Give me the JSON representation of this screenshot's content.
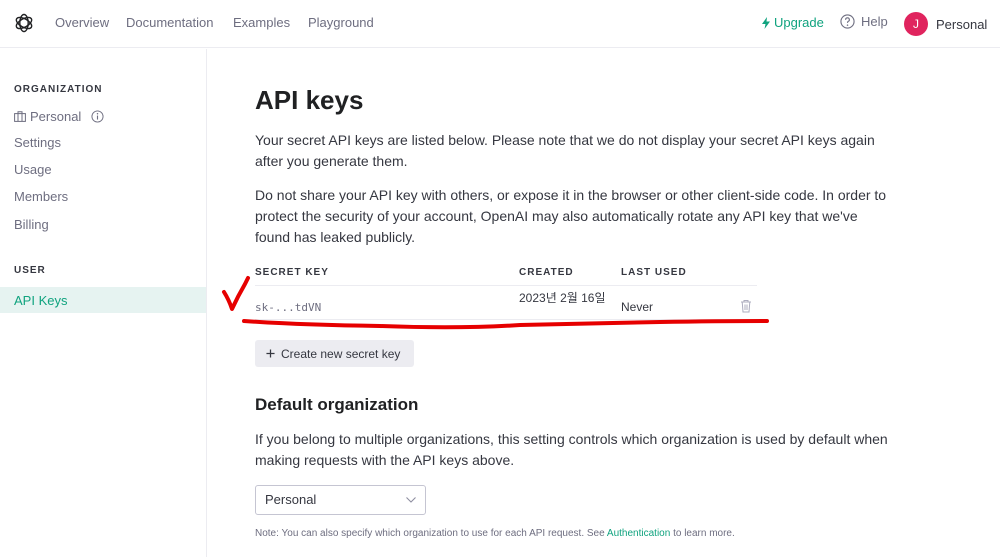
{
  "nav": {
    "links": [
      "Overview",
      "Documentation",
      "Examples",
      "Playground"
    ],
    "upgrade": "Upgrade",
    "help": "Help",
    "account": "Personal",
    "avatar_initial": "J"
  },
  "sidebar": {
    "org_heading": "ORGANIZATION",
    "org_items": [
      "Personal",
      "Settings",
      "Usage",
      "Members",
      "Billing"
    ],
    "user_heading": "USER",
    "user_items": [
      "API Keys"
    ]
  },
  "main": {
    "title": "API keys",
    "intro": "Your secret API keys are listed below. Please note that we do not display your secret API keys again after you generate them.",
    "warning": "Do not share your API key with others, or expose it in the browser or other client-side code. In order to protect the security of your account, OpenAI may also automatically rotate any API key that we've found has leaked publicly.",
    "table": {
      "headers": [
        "SECRET KEY",
        "CREATED",
        "LAST USED"
      ],
      "rows": [
        {
          "key": "sk-...tdVN",
          "created": "2023년 2월 16일",
          "last_used": "Never"
        }
      ]
    },
    "create_button": "Create new secret key",
    "default_org_title": "Default organization",
    "default_org_desc": "If you belong to multiple organizations, this setting controls which organization is used by default when making requests with the API keys above.",
    "select_value": "Personal",
    "note_prefix": "Note: You can also specify which organization to use for each API request. See",
    "note_link": "Authentication",
    "note_suffix": "to learn more."
  },
  "colors": {
    "accent": "#10a37f",
    "avatar": "#e0245e",
    "annotation": "#e60000"
  }
}
